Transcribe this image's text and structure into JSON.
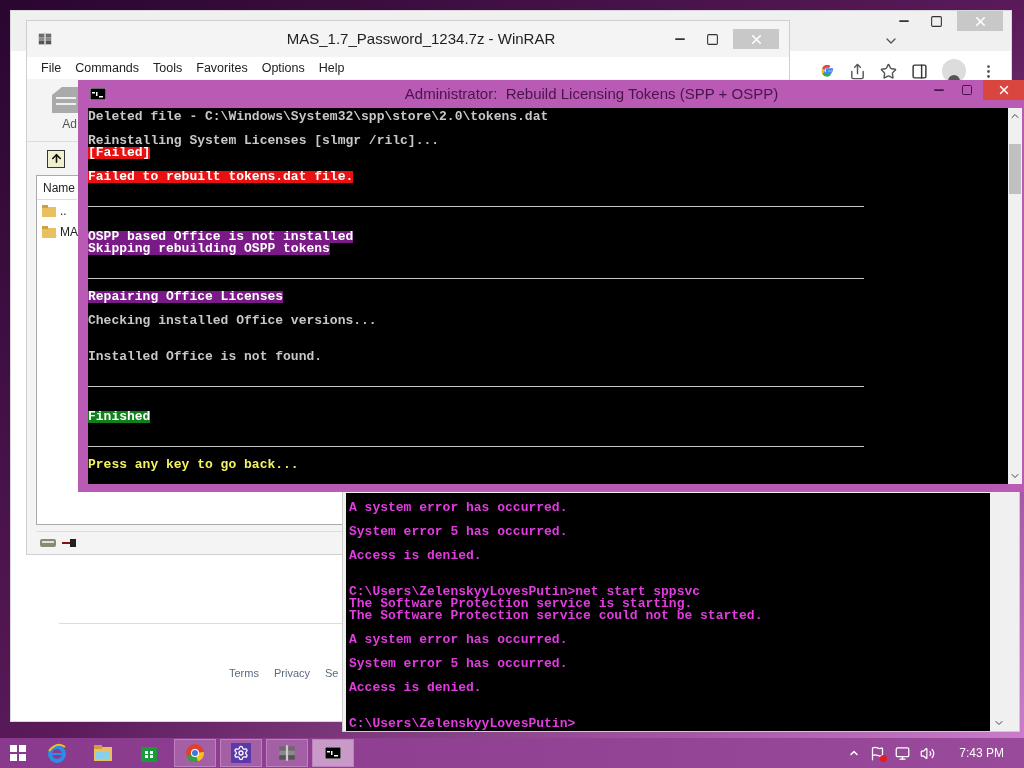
{
  "browser_window": {
    "footer_links": [
      "Terms",
      "Privacy",
      "Se"
    ]
  },
  "archiver_window": {
    "title": "MAS_1.7_Password_1234.7z - WinRAR",
    "menu": [
      "File",
      "Commands",
      "Tools",
      "Favorites",
      "Options",
      "Help"
    ],
    "toolbar_button": "Ad",
    "column": "Name",
    "files": [
      {
        "name": ".."
      },
      {
        "name": "MA"
      }
    ]
  },
  "background_console": {
    "lines": [
      {
        "kind": "text",
        "text": "A system error has occurred."
      },
      {
        "kind": "blank"
      },
      {
        "kind": "text",
        "text": "System error 5 has occurred."
      },
      {
        "kind": "blank"
      },
      {
        "kind": "text",
        "text": "Access is denied."
      },
      {
        "kind": "blank"
      },
      {
        "kind": "blank"
      },
      {
        "kind": "text",
        "text": "C:\\Users\\ZelenskyyLovesPutin>net start sppsvc"
      },
      {
        "kind": "text",
        "text": "The Software Protection service is starting."
      },
      {
        "kind": "text",
        "text": "The Software Protection service could not be started."
      },
      {
        "kind": "blank"
      },
      {
        "kind": "text",
        "text": "A system error has occurred."
      },
      {
        "kind": "blank"
      },
      {
        "kind": "text",
        "text": "System error 5 has occurred."
      },
      {
        "kind": "blank"
      },
      {
        "kind": "text",
        "text": "Access is denied."
      },
      {
        "kind": "blank"
      },
      {
        "kind": "blank"
      },
      {
        "kind": "text",
        "text": "C:\\Users\\ZelenskyyLovesPutin>"
      }
    ]
  },
  "console_window": {
    "title": "Administrator:  Rebuild Licensing Tokens (SPP + OSPP)",
    "lines": [
      {
        "kind": "text",
        "text": "Deleted file - C:\\Windows\\System32\\spp\\store\\2.0\\tokens.dat"
      },
      {
        "kind": "blank"
      },
      {
        "kind": "text",
        "text": "Reinstalling System Licenses [slmgr /rilc]..."
      },
      {
        "kind": "error",
        "text": "[Failed]"
      },
      {
        "kind": "blank"
      },
      {
        "kind": "error",
        "text": "Failed to rebuilt tokens.dat file."
      },
      {
        "kind": "blank"
      },
      {
        "kind": "rule"
      },
      {
        "kind": "blank"
      },
      {
        "kind": "blank"
      },
      {
        "kind": "notice",
        "text": "OSPP based Office is not installed"
      },
      {
        "kind": "notice",
        "text": "Skipping rebuilding OSPP tokens"
      },
      {
        "kind": "blank"
      },
      {
        "kind": "rule"
      },
      {
        "kind": "blank"
      },
      {
        "kind": "notice",
        "text": "Repairing Office Licenses"
      },
      {
        "kind": "blank"
      },
      {
        "kind": "text",
        "text": "Checking installed Office versions..."
      },
      {
        "kind": "blank"
      },
      {
        "kind": "blank"
      },
      {
        "kind": "text",
        "text": "Installed Office is not found."
      },
      {
        "kind": "blank"
      },
      {
        "kind": "rule"
      },
      {
        "kind": "blank"
      },
      {
        "kind": "blank"
      },
      {
        "kind": "success",
        "text": "Finished"
      },
      {
        "kind": "blank"
      },
      {
        "kind": "rule"
      },
      {
        "kind": "blank"
      },
      {
        "kind": "prompt",
        "text": "Press any key to go back..."
      }
    ]
  },
  "taskbar": {
    "apps": [
      {
        "kind": "start",
        "running": false,
        "selected": false
      },
      {
        "kind": "ie",
        "running": false,
        "selected": false
      },
      {
        "kind": "explorer",
        "running": false,
        "selected": false
      },
      {
        "kind": "store",
        "running": false,
        "selected": false
      },
      {
        "kind": "chrome",
        "running": true,
        "selected": false
      },
      {
        "kind": "settings",
        "running": true,
        "selected": false
      },
      {
        "kind": "winrar",
        "running": true,
        "selected": false
      },
      {
        "kind": "cmd",
        "running": true,
        "selected": true
      }
    ],
    "clock": "7:43 PM"
  }
}
